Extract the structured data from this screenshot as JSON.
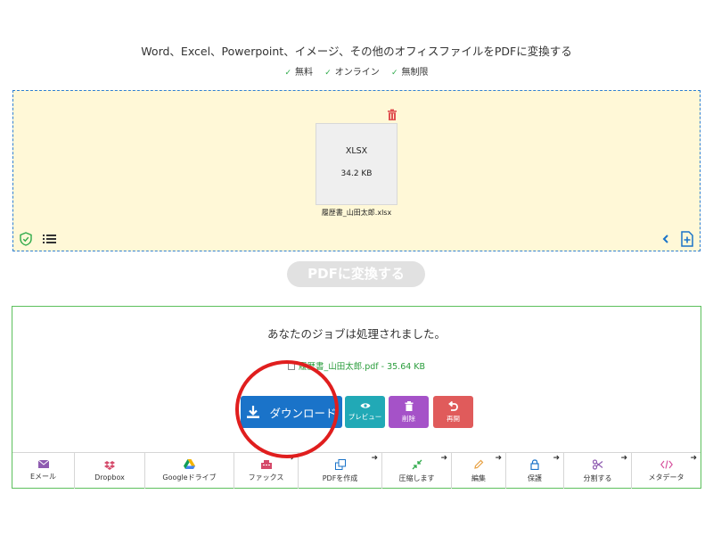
{
  "header": {
    "headline": "Word、Excel、Powerpoint、イメージ、その他のオフィスファイルをPDFに変換する",
    "features": [
      "無料",
      "オンライン",
      "無制限"
    ]
  },
  "dropzone": {
    "file": {
      "type": "XLSX",
      "size": "34.2 KB",
      "name": "履歴書_山田太郎.xlsx"
    }
  },
  "convert_button": "PDFに変換する",
  "result": {
    "message": "あなたのジョブは処理されました。",
    "file_label": "履歴書_山田太郎.pdf - 35.64 KB",
    "download_label": "ダウンロード",
    "preview_label": "プレビュー",
    "delete_label": "削除",
    "restart_label": "再開"
  },
  "tools": [
    {
      "label": "Eメール",
      "arrow": ""
    },
    {
      "label": "Dropbox",
      "arrow": ""
    },
    {
      "label": "Googleドライブ",
      "arrow": ""
    },
    {
      "label": "ファックス",
      "arrow": "➜"
    },
    {
      "label": "PDFを作成",
      "arrow": "➜"
    },
    {
      "label": "圧縮します",
      "arrow": "➜"
    },
    {
      "label": "編集",
      "arrow": "➜"
    },
    {
      "label": "保護",
      "arrow": "➜"
    },
    {
      "label": "分割する",
      "arrow": "➜"
    },
    {
      "label": "メタデータ",
      "arrow": "➜"
    }
  ],
  "colors": {
    "accent_blue": "#1a73c9",
    "preview_teal": "#21a9b6",
    "delete_purple": "#a552c8",
    "restart_red": "#e05b5b",
    "success_green": "#2a9d3c",
    "dropzone_bg": "#fff8d7",
    "annotation_red": "#e01e1e"
  }
}
